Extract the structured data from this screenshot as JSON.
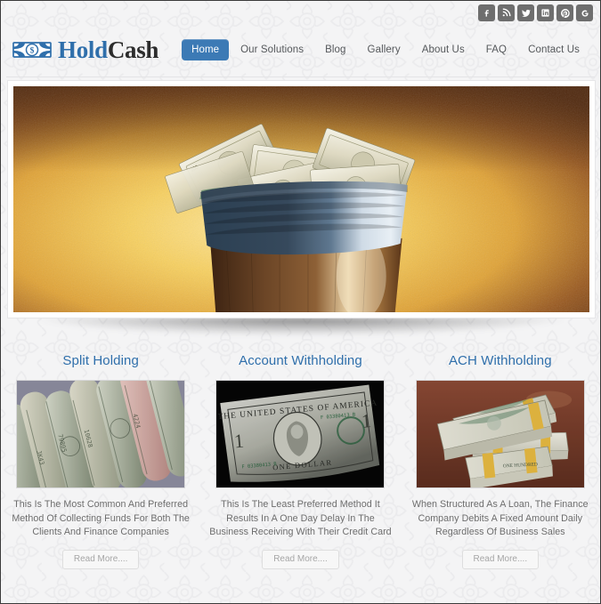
{
  "site": {
    "logo_primary": "Hold",
    "logo_secondary": "Cash",
    "logo_icon": "banknote-dollar-icon",
    "accent_color": "#2f6fab",
    "nav_active_color": "#3c7ab5",
    "heading_color": "#2f6fab",
    "body_text_color": "#6d6d6d",
    "background_color": "#f4f4f5"
  },
  "social": {
    "items": [
      {
        "name": "facebook",
        "label": "f",
        "icon": "facebook-icon"
      },
      {
        "name": "rss",
        "label": "",
        "icon": "rss-icon"
      },
      {
        "name": "twitter",
        "label": "",
        "icon": "twitter-icon"
      },
      {
        "name": "linkedin",
        "label": "in",
        "icon": "linkedin-icon"
      },
      {
        "name": "pinterest",
        "label": "P",
        "icon": "pinterest-icon"
      },
      {
        "name": "googleplus",
        "label": "G",
        "icon": "google-plus-icon"
      }
    ]
  },
  "nav": {
    "items": [
      {
        "label": "Home",
        "active": true
      },
      {
        "label": "Our Solutions",
        "active": false
      },
      {
        "label": "Blog",
        "active": false
      },
      {
        "label": "Gallery",
        "active": false
      },
      {
        "label": "About Us",
        "active": false
      },
      {
        "label": "FAQ",
        "active": false
      },
      {
        "label": "Contact Us",
        "active": false
      }
    ]
  },
  "hero": {
    "image_alt": "Burlap money sack filled with US hundred dollar bills against a golden textured wall",
    "image_name": "money-sack-hero-image"
  },
  "services": {
    "items": [
      {
        "title": "Split Holding",
        "text": "This Is The Most Common And Preferred Method Of Collecting Funds For Both The Clients And Finance Companies",
        "button_label": "Read More....",
        "image_alt": "Rolled up US banknotes of various denominations",
        "image_name": "rolled-banknotes-image"
      },
      {
        "title": "Account Withholding",
        "text": "This Is The Least Preferred Method It Results In A One Day Delay In The Business Receiving With Their Credit Card",
        "button_label": "Read More....",
        "image_alt": "Close-up of a United States one dollar bill on a dark background",
        "image_name": "one-dollar-bill-image"
      },
      {
        "title": "ACH Withholding",
        "text": "When Structured As A Loan, The Finance Company Debits A Fixed Amount Daily Regardless Of Business Sales",
        "button_label": "Read More....",
        "image_alt": "Banded stacks of US hundred dollar bills on a wooden table",
        "image_name": "cash-stacks-image"
      }
    ]
  }
}
